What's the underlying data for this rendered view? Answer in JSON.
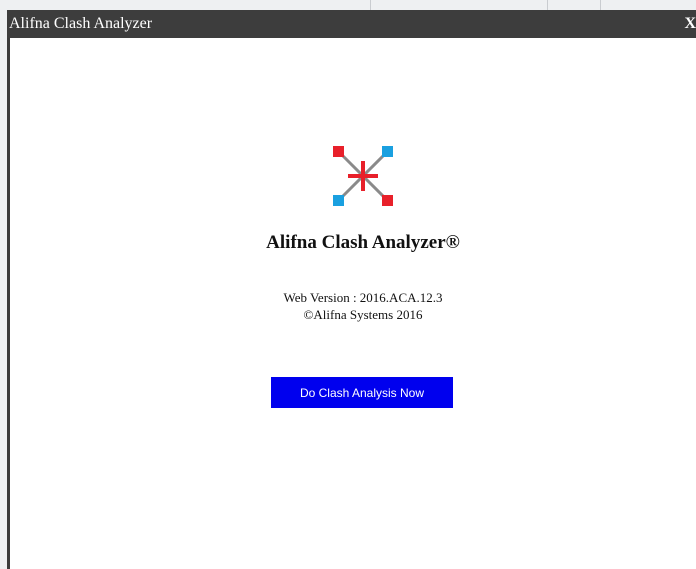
{
  "window": {
    "title": "Alifna Clash Analyzer",
    "close_label": "X"
  },
  "about": {
    "app_name": "Alifna Clash Analyzer®",
    "version_line": "Web Version : 2016.ACA.12.3",
    "copyright_line": "©Alifna Systems 2016",
    "logo_icon": "clash-analyzer-logo-icon"
  },
  "actions": {
    "analyze_label": "Do Clash Analysis Now"
  },
  "colors": {
    "titlebar": "#3d3d3d",
    "button": "#0000ee",
    "logo_red": "#e8202a",
    "logo_blue": "#1aa0e0",
    "logo_gray": "#8a8a8a"
  }
}
